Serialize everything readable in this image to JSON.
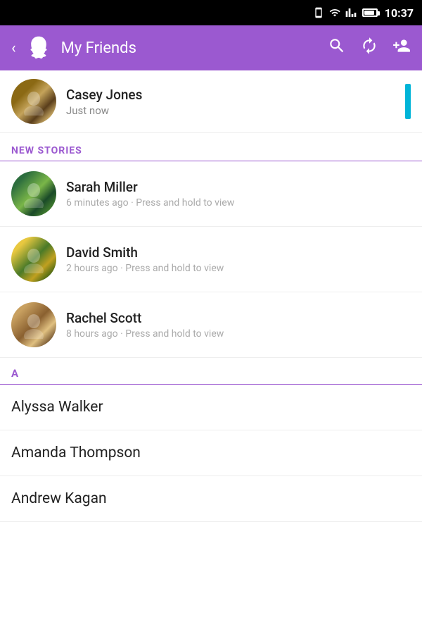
{
  "statusBar": {
    "time": "10:37"
  },
  "toolbar": {
    "title": "My Friends",
    "backLabel": "‹",
    "searchLabel": "search",
    "refreshLabel": "refresh",
    "addFriendLabel": "add friend"
  },
  "recentSnap": {
    "name": "Casey Jones",
    "time": "Just now"
  },
  "storiesSection": {
    "label": "NEW STORIES",
    "stories": [
      {
        "name": "Sarah Miller",
        "time": "6 minutes ago · Press and hold to view"
      },
      {
        "name": "David Smith",
        "time": "2 hours ago · Press and hold to view"
      },
      {
        "name": "Rachel Scott",
        "time": "8 hours ago · Press and hold to view"
      }
    ]
  },
  "friendsSection": {
    "alphaLabel": "A",
    "friends": [
      {
        "name": "Alyssa Walker"
      },
      {
        "name": "Amanda Thompson"
      },
      {
        "name": "Andrew Kagan"
      }
    ]
  }
}
